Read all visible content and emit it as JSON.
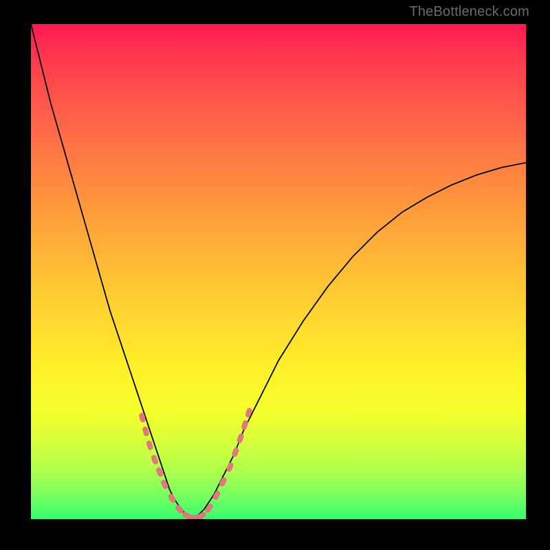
{
  "header": {
    "watermark": "TheBottleneck.com"
  },
  "chart_data": {
    "type": "line",
    "title": "",
    "xlabel": "",
    "ylabel": "",
    "xlim": [
      0,
      100
    ],
    "ylim": [
      0,
      100
    ],
    "grid": false,
    "series": [
      {
        "name": "curve-left",
        "x": [
          0,
          2,
          4,
          6,
          8,
          10,
          12,
          14,
          16,
          18,
          20,
          22,
          24,
          26,
          27,
          28,
          29,
          30,
          31,
          32,
          33
        ],
        "values": [
          100,
          92,
          84,
          77,
          70,
          63,
          56,
          49,
          42,
          36,
          30,
          24,
          18,
          12,
          9,
          6,
          4,
          2.5,
          1.3,
          0.4,
          0
        ]
      },
      {
        "name": "curve-right",
        "x": [
          33,
          35,
          37,
          39,
          41,
          43,
          46,
          50,
          55,
          60,
          65,
          70,
          75,
          80,
          85,
          90,
          95,
          100
        ],
        "values": [
          0,
          2,
          5,
          9,
          13,
          18,
          24,
          32,
          40,
          47,
          53,
          58,
          62,
          65,
          67.5,
          69.5,
          71,
          72
        ]
      }
    ],
    "markers": {
      "name": "dotted-segments",
      "points": [
        {
          "x": 22.5,
          "y": 20.5
        },
        {
          "x": 23.2,
          "y": 17.7
        },
        {
          "x": 24.0,
          "y": 14.9
        },
        {
          "x": 25.0,
          "y": 12.0
        },
        {
          "x": 26.0,
          "y": 9.5
        },
        {
          "x": 27.0,
          "y": 7.0
        },
        {
          "x": 28.5,
          "y": 4.2
        },
        {
          "x": 30.0,
          "y": 2.0
        },
        {
          "x": 31.5,
          "y": 0.7
        },
        {
          "x": 33.0,
          "y": 0.3
        },
        {
          "x": 34.5,
          "y": 0.7
        },
        {
          "x": 36.0,
          "y": 2.2
        },
        {
          "x": 37.5,
          "y": 4.8
        },
        {
          "x": 38.8,
          "y": 7.5
        },
        {
          "x": 40.2,
          "y": 10.5
        },
        {
          "x": 41.3,
          "y": 13.5
        },
        {
          "x": 42.3,
          "y": 16.3
        },
        {
          "x": 43.2,
          "y": 19.0
        },
        {
          "x": 44.0,
          "y": 21.5
        }
      ]
    },
    "colors": {
      "gradient_top": "#ff1a53",
      "gradient_mid1": "#ff8a3f",
      "gradient_mid2": "#fff029",
      "gradient_bottom": "#35ff6e",
      "curve": "#000000",
      "marker": "#e07a7a",
      "frame": "#000000"
    }
  }
}
